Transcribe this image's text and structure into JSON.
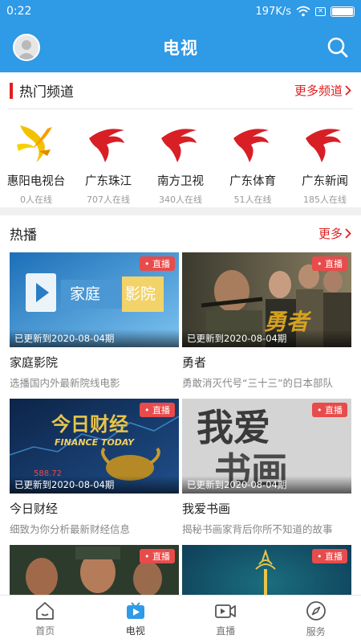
{
  "status_bar": {
    "time": "0:22",
    "network_speed": "197K/s",
    "sim_status_glyph": "✕",
    "icons": [
      "wifi-icon",
      "no-sim-icon",
      "battery-icon"
    ]
  },
  "header": {
    "title": "电视",
    "left_icon": "avatar-icon",
    "right_icon": "search-icon"
  },
  "hot_channels": {
    "title": "热门频道",
    "more": "更多频道",
    "items": [
      {
        "name": "惠阳电视台",
        "online": "0人在线",
        "logo": "huiyang-logo"
      },
      {
        "name": "广东珠江",
        "online": "707人在线",
        "logo": "guangdong-tv-logo"
      },
      {
        "name": "南方卫视",
        "online": "340人在线",
        "logo": "guangdong-tv-logo"
      },
      {
        "name": "广东体育",
        "online": "51人在线",
        "logo": "guangdong-tv-logo"
      },
      {
        "name": "广东新闻",
        "online": "185人在线",
        "logo": "guangdong-tv-logo"
      }
    ]
  },
  "hot_play": {
    "title": "热播",
    "more": "更多",
    "live_label": "直播",
    "items": [
      {
        "title": "家庭影院",
        "subtitle": "选播国内外最新院线电影",
        "updated": "已更新到2020-08-04期",
        "thumb_text": [
          "家庭",
          "影院"
        ],
        "colors": {
          "bg1": "#1c6fb8",
          "bg2": "#6db7ea"
        }
      },
      {
        "title": "勇者",
        "subtitle": "勇敢消灭代号“三十三”的日本部队",
        "updated": "已更新到2020-08-04期",
        "thumb_text": [
          "勇者"
        ],
        "colors": {
          "bg1": "#3b3a2e",
          "bg2": "#8a7f63"
        }
      },
      {
        "title": "今日财经",
        "subtitle": "细致为你分析最新财经信息",
        "updated": "已更新到2020-08-04期",
        "thumb_text": [
          "今日财经",
          "FINANCE TODAY",
          "588.72"
        ],
        "colors": {
          "bg1": "#0d2448",
          "bg2": "#1f4f8a"
        }
      },
      {
        "title": "我爱书画",
        "subtitle": "揭秘书画家背后你所不知道的故事",
        "updated": "已更新到2020-08-04期",
        "thumb_text": [
          "我爱",
          "书画"
        ],
        "colors": {
          "bg1": "#bdbdbd",
          "bg2": "#dcdcdc"
        }
      },
      {
        "title": "",
        "subtitle": "",
        "updated": "",
        "thumb_text": [],
        "colors": {
          "bg1": "#2d3b2c",
          "bg2": "#a06a4a"
        }
      },
      {
        "title": "",
        "subtitle": "",
        "updated": "",
        "thumb_text": [],
        "colors": {
          "bg1": "#0d3a55",
          "bg2": "#1b6e7e"
        }
      }
    ]
  },
  "tabbar": {
    "items": [
      {
        "label": "首页",
        "icon": "home-icon",
        "active": false
      },
      {
        "label": "电视",
        "icon": "tv-icon",
        "active": true
      },
      {
        "label": "直播",
        "icon": "video-camera-icon",
        "active": false
      },
      {
        "label": "服务",
        "icon": "compass-icon",
        "active": false
      }
    ]
  },
  "colors": {
    "brand_blue": "#2f9ae6",
    "accent_red": "#e02020",
    "live_tag": "#e84b4b"
  }
}
